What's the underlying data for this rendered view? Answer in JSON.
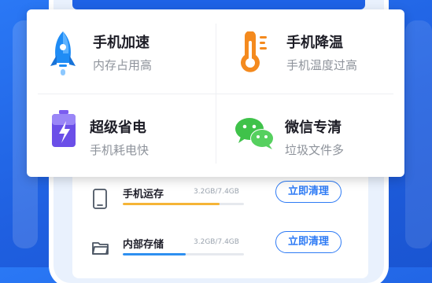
{
  "features": [
    {
      "title": "手机加速",
      "subtitle": "内存占用高",
      "icon": "rocket-icon"
    },
    {
      "title": "手机降温",
      "subtitle": "手机温度过高",
      "icon": "thermometer-icon"
    },
    {
      "title": "超级省电",
      "subtitle": "手机耗电快",
      "icon": "battery-icon"
    },
    {
      "title": "微信专清",
      "subtitle": "垃圾文件多",
      "icon": "wechat-icon"
    }
  ],
  "storage": [
    {
      "title": "手机运存",
      "usage": "3.2GB/7.4GB",
      "button": "立即清理",
      "icon": "phone-icon",
      "fill_fraction": 0.8,
      "color": "#f5b436"
    },
    {
      "title": "内部存储",
      "usage": "3.2GB/7.4GB",
      "button": "立即清理",
      "icon": "folder-icon",
      "fill_fraction": 0.52,
      "color": "#2e8ff0"
    }
  ],
  "colors": {
    "accent": "#2e7bf5",
    "background": "#1f5fe0",
    "wechat": "#3fc24a",
    "thermometer": "#f48a1e"
  }
}
